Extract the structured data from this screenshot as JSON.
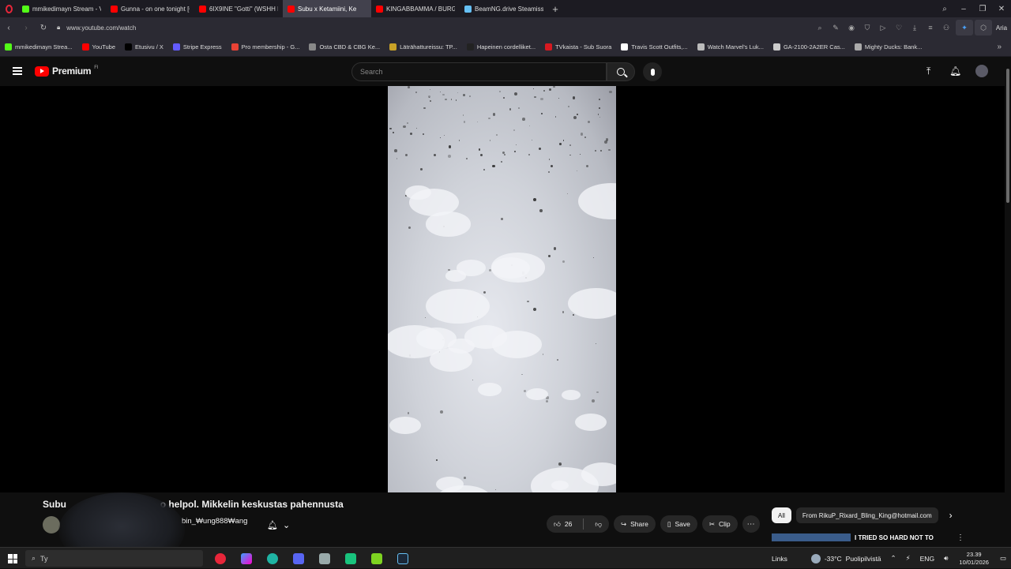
{
  "browser": {
    "tabs": [
      {
        "title": "mmikedimayn Stream - V",
        "favicon_color": "#53fc18",
        "active": false
      },
      {
        "title": "Gunna - on one tonight [O",
        "favicon_color": "#ff0000",
        "active": false
      },
      {
        "title": "6IX9INE \"Gotti\" (WSHH E",
        "favicon_color": "#ff0000",
        "active": false
      },
      {
        "title": "Subu x Ketamiini, Ke",
        "favicon_color": "#ff0000",
        "active": true
      },
      {
        "title": "KINGABBAMMA / BURGE",
        "favicon_color": "#ff0000",
        "active": false
      },
      {
        "title": "BeamNG.drive Steamissä",
        "favicon_color": "#66c0f4",
        "active": false
      }
    ],
    "new_tab_label": "+",
    "url": "www.youtube.com/watch",
    "ai_label": "Aria",
    "bookmarks": [
      {
        "label": "mmikedimayn Strea...",
        "color": "#53fc18"
      },
      {
        "label": "YouTube",
        "color": "#ff0000"
      },
      {
        "label": "Etusivu / X",
        "color": "#000000"
      },
      {
        "label": "Stripe Express",
        "color": "#635bff"
      },
      {
        "label": "Pro membership - G...",
        "color": "#e94235"
      },
      {
        "label": "Osta CBD & CBG Ke...",
        "color": "#888888"
      },
      {
        "label": "Läträhattureissu: TP...",
        "color": "#c9a227"
      },
      {
        "label": "Hapeinen cordelliket...",
        "color": "#222222"
      },
      {
        "label": "TVkaista - Sub Suora",
        "color": "#d71920"
      },
      {
        "label": "Travis Scott Outfits,...",
        "color": "#ffffff"
      },
      {
        "label": "Watch Marvel's Luk...",
        "color": "#bbbbbb"
      },
      {
        "label": "GA-2100-2A2ER Cas...",
        "color": "#cccccc"
      },
      {
        "label": "Mighty Ducks: Bank...",
        "color": "#aaaaaa"
      }
    ]
  },
  "youtube": {
    "logo_text": "Premium",
    "logo_region": "FI",
    "search_placeholder": "Search",
    "video_title_start": "Subu",
    "video_title_end": "o helpol. Mikkelin keskustas pahennusta",
    "channel_name": "bin_₩ung888₩ang",
    "likes": "26",
    "share_label": "Share",
    "save_label": "Save",
    "clip_label": "Clip",
    "chips": [
      "All",
      "From RikuP_Rixard_Bling_King@hotmail.com"
    ],
    "rec_title": "I TRIED SO HARD NOT TO LAUGH"
  },
  "taskbar": {
    "search_text": "Ty",
    "links_label": "Links",
    "temperature": "-33°C",
    "weather": "Puolipilvistä",
    "language": "ENG",
    "time": "23.39",
    "date": "10/01/2026"
  },
  "colors": {
    "youtube_red": "#ff0000",
    "background": "#0f0f0f"
  }
}
